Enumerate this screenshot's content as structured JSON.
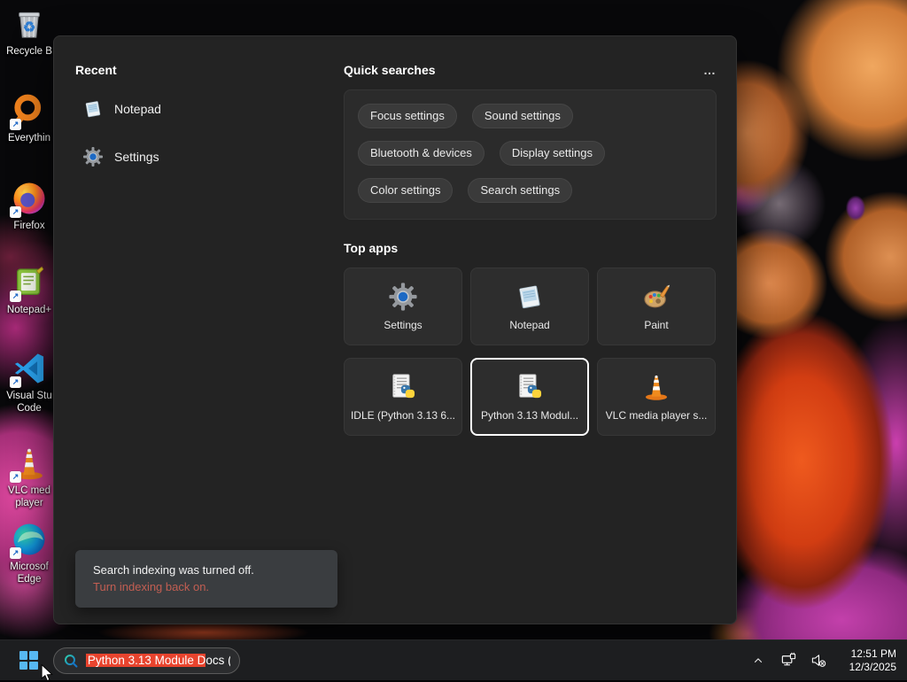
{
  "colors": {
    "panel_bg": "#232323",
    "selection_red": "#e8442e",
    "notice_link": "#c25e52",
    "start_blue": "#57b8f2"
  },
  "desktop": {
    "icons": [
      {
        "name": "recycle-bin",
        "line1": "Recycle B",
        "line2": ""
      },
      {
        "name": "everything",
        "line1": "Everythin",
        "line2": ""
      },
      {
        "name": "firefox",
        "line1": "Firefox",
        "line2": ""
      },
      {
        "name": "notepad-plus-plus",
        "line1": "Notepad+",
        "line2": ""
      },
      {
        "name": "visual-studio-code",
        "line1": "Visual Stu",
        "line2": "Code"
      },
      {
        "name": "vlc-media-player",
        "line1": "VLC med",
        "line2": "player"
      },
      {
        "name": "microsoft-edge",
        "line1": "Microsof",
        "line2": "Edge"
      }
    ]
  },
  "panel": {
    "recent": {
      "title": "Recent",
      "items": [
        {
          "label": "Notepad"
        },
        {
          "label": "Settings"
        }
      ]
    },
    "quick_searches": {
      "title": "Quick searches",
      "more": "…",
      "pills": [
        "Focus settings",
        "Sound settings",
        "Bluetooth & devices",
        "Display settings",
        "Color settings",
        "Search settings"
      ]
    },
    "top_apps": {
      "title": "Top apps",
      "tiles": [
        {
          "label": "Settings",
          "selected": false
        },
        {
          "label": "Notepad",
          "selected": false
        },
        {
          "label": "Paint",
          "selected": false
        },
        {
          "label": "IDLE (Python 3.13 6...",
          "selected": false
        },
        {
          "label": "Python 3.13 Modul...",
          "selected": true
        },
        {
          "label": "VLC media player s...",
          "selected": false
        }
      ]
    },
    "indexing_notice": {
      "message": "Search indexing was turned off.",
      "action": "Turn indexing back on."
    }
  },
  "taskbar": {
    "search": {
      "selected_text": "Python 3.13 Module D",
      "rest_text": "ocs ("
    },
    "clock": {
      "time": "12:51 PM",
      "date": "12/3/2025"
    }
  }
}
